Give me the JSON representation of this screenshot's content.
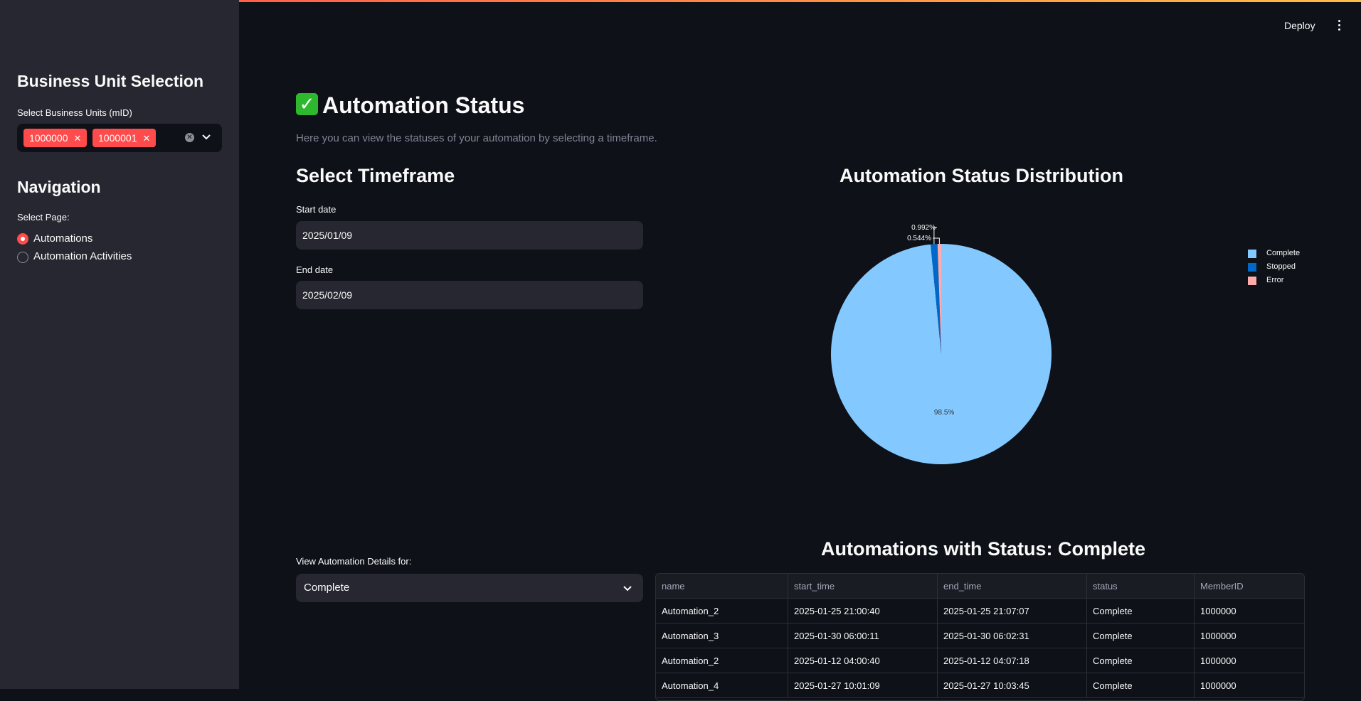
{
  "header": {
    "deploy_label": "Deploy"
  },
  "sidebar": {
    "bu_heading": "Business Unit Selection",
    "bu_label": "Select Business Units (mID)",
    "bu_tags": [
      "1000000",
      "1000001"
    ],
    "nav_heading": "Navigation",
    "page_label": "Select Page:",
    "pages": [
      {
        "label": "Automations",
        "selected": true
      },
      {
        "label": "Automation Activities",
        "selected": false
      }
    ]
  },
  "main": {
    "title": "Automation Status",
    "subtitle": "Here you can view the statuses of your automation by selecting a timeframe.",
    "timeframe_heading": "Select Timeframe",
    "start_label": "Start date",
    "start_value": "2025/01/09",
    "end_label": "End date",
    "end_value": "2025/02/09",
    "details_label": "View Automation Details for:",
    "details_value": "Complete",
    "table_heading": "Automations with Status: Complete"
  },
  "chart_data": {
    "type": "pie",
    "title": "Automation Status Distribution",
    "labels": [
      "Complete",
      "Stopped",
      "Error"
    ],
    "values": [
      98.5,
      0.992,
      0.544
    ],
    "value_labels": [
      "98.5%",
      "0.992%",
      "0.544%"
    ],
    "colors": [
      "#83c9ff",
      "#0068c9",
      "#ffabab"
    ],
    "legend_position": "right"
  },
  "table": {
    "columns": [
      "name",
      "start_time",
      "end_time",
      "status",
      "MemberID"
    ],
    "rows": [
      [
        "Automation_2",
        "2025-01-25 21:00:40",
        "2025-01-25 21:07:07",
        "Complete",
        "1000000"
      ],
      [
        "Automation_3",
        "2025-01-30 06:00:11",
        "2025-01-30 06:02:31",
        "Complete",
        "1000000"
      ],
      [
        "Automation_2",
        "2025-01-12 04:00:40",
        "2025-01-12 04:07:18",
        "Complete",
        "1000000"
      ],
      [
        "Automation_4",
        "2025-01-27 10:01:09",
        "2025-01-27 10:03:45",
        "Complete",
        "1000000"
      ]
    ]
  }
}
